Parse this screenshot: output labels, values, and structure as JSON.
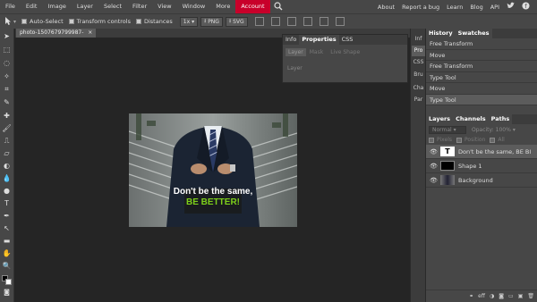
{
  "menubar": {
    "items": [
      "File",
      "Edit",
      "Image",
      "Layer",
      "Select",
      "Filter",
      "View",
      "Window",
      "More",
      "Account"
    ],
    "right_items": [
      "About",
      "Report a bug",
      "Learn",
      "Blog",
      "API"
    ]
  },
  "options": {
    "auto_select": "Auto-Select",
    "transform_controls": "Transform controls",
    "distances": "Distances",
    "zoom": "1x",
    "png": "PNG",
    "svg": "SVG"
  },
  "document": {
    "tab_title": "photo-1507679799987-"
  },
  "canvas": {
    "text_line1": "Don't be the same,",
    "text_line2": "BE BETTER!"
  },
  "properties": {
    "tabs": [
      "Info",
      "Properties",
      "CSS"
    ],
    "subtabs": [
      "Layer",
      "Mask",
      "Live Shape"
    ],
    "section": "Layer"
  },
  "strip": {
    "tabs": [
      "Inf",
      "Pro",
      "CSS",
      "Bru",
      "Cha",
      "Par"
    ]
  },
  "history": {
    "tabs": [
      "History",
      "Swatches"
    ],
    "items": [
      "Free Transform",
      "Move",
      "Free Transform",
      "Type Tool",
      "Move",
      "Type Tool"
    ]
  },
  "layers": {
    "tabs": [
      "Layers",
      "Channels",
      "Paths"
    ],
    "blend": "Normal",
    "opacity_label": "Opacity:",
    "opacity_value": "100%",
    "lock_label": "Pixels",
    "lock_position": "Position",
    "lock_all": "All",
    "items": [
      {
        "name": "Don't be the same, BE BI",
        "thumb": "T"
      },
      {
        "name": "Shape 1",
        "thumb": ""
      },
      {
        "name": "Background",
        "thumb": ""
      }
    ],
    "footer_fx": "eff"
  },
  "colors": {
    "accent": "#c8002a",
    "green_text": "#7dcf1a"
  }
}
